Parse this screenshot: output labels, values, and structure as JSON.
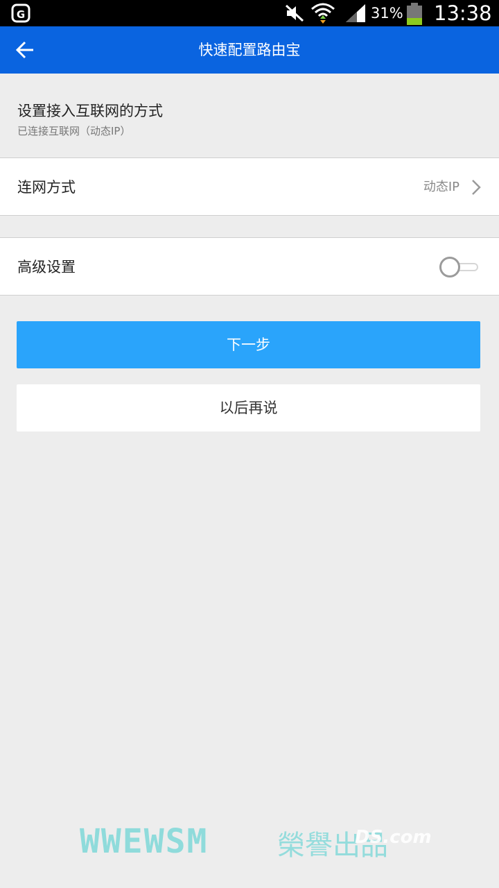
{
  "status_bar": {
    "battery_percent": "31%",
    "time": "13:38",
    "icons": [
      "notification-app-icon",
      "mute-icon",
      "wifi-icon",
      "signal-icon",
      "battery-icon"
    ]
  },
  "app_bar": {
    "title": "快速配置路由宝",
    "back_icon": "arrow-left-icon"
  },
  "section": {
    "title": "设置接入互联网的方式",
    "subtitle": "已连接互联网（动态IP）"
  },
  "rows": {
    "connection": {
      "label": "连网方式",
      "value": "动态IP",
      "chevron": "chevron-right-icon"
    },
    "advanced": {
      "label": "高级设置",
      "toggle_on": false
    }
  },
  "buttons": {
    "next": "下一步",
    "later": "以后再说"
  },
  "watermark": {
    "text": "WWEWSM",
    "text_cn": "榮譽出品",
    "logo": "DS.com"
  },
  "colors": {
    "app_bar": "#0a64e0",
    "primary_button": "#2aa4fb",
    "background": "#ededed"
  }
}
